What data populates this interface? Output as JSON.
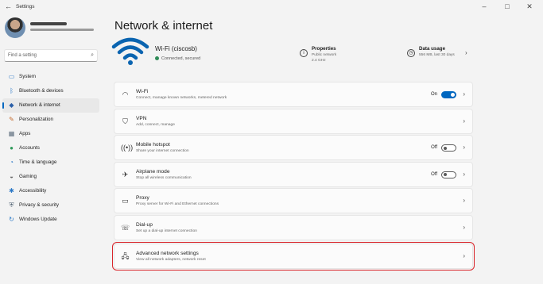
{
  "window": {
    "title": "Settings"
  },
  "sidebar": {
    "search_placeholder": "Find a setting",
    "items": [
      {
        "label": "System",
        "icon": "monitor-icon",
        "color": "#2b78c6"
      },
      {
        "label": "Bluetooth & devices",
        "icon": "bluetooth-icon",
        "color": "#2b78c6"
      },
      {
        "label": "Network & internet",
        "icon": "network-icon",
        "color": "#2b5fa8",
        "active": true
      },
      {
        "label": "Personalization",
        "icon": "brush-icon",
        "color": "#c46a2d"
      },
      {
        "label": "Apps",
        "icon": "apps-icon",
        "color": "#5a6b7b"
      },
      {
        "label": "Accounts",
        "icon": "person-icon",
        "color": "#2e9a5a"
      },
      {
        "label": "Time & language",
        "icon": "globe-clock-icon",
        "color": "#2b78c6"
      },
      {
        "label": "Gaming",
        "icon": "gamepad-icon",
        "color": "#666666"
      },
      {
        "label": "Accessibility",
        "icon": "accessibility-icon",
        "color": "#2b78c6"
      },
      {
        "label": "Privacy & security",
        "icon": "shield-icon",
        "color": "#5a6b7b"
      },
      {
        "label": "Windows Update",
        "icon": "update-icon",
        "color": "#2b78c6"
      }
    ]
  },
  "main": {
    "title": "Network & internet",
    "hero": {
      "name": "Wi-Fi (ciscosb)",
      "status": "Connected, secured",
      "properties": {
        "title": "Properties",
        "line1": "Public network",
        "line2": "2.4 GHz"
      },
      "data_usage": {
        "title": "Data usage",
        "line1": "556 MB, last 30 days"
      }
    },
    "rows": [
      {
        "title": "Wi-Fi",
        "subtitle": "Connect, manage known networks, metered network",
        "icon": "wifi-icon",
        "toggle": "On"
      },
      {
        "title": "VPN",
        "subtitle": "Add, connect, manage",
        "icon": "vpn-shield-icon"
      },
      {
        "title": "Mobile hotspot",
        "subtitle": "Share your internet connection",
        "icon": "hotspot-icon",
        "toggle": "Off"
      },
      {
        "title": "Airplane mode",
        "subtitle": "Stop all wireless communication",
        "icon": "airplane-icon",
        "toggle": "Off"
      },
      {
        "title": "Proxy",
        "subtitle": "Proxy server for Wi-Fi and Ethernet connections",
        "icon": "proxy-icon"
      },
      {
        "title": "Dial-up",
        "subtitle": "Set up a dial-up internet connection",
        "icon": "dialup-icon"
      },
      {
        "title": "Advanced network settings",
        "subtitle": "View all network adapters, network reset",
        "icon": "advanced-network-icon",
        "highlighted": true
      }
    ]
  },
  "colors": {
    "accent": "#0067c0",
    "highlight_border": "#d9262b",
    "connected_dot": "#2e8b57"
  }
}
